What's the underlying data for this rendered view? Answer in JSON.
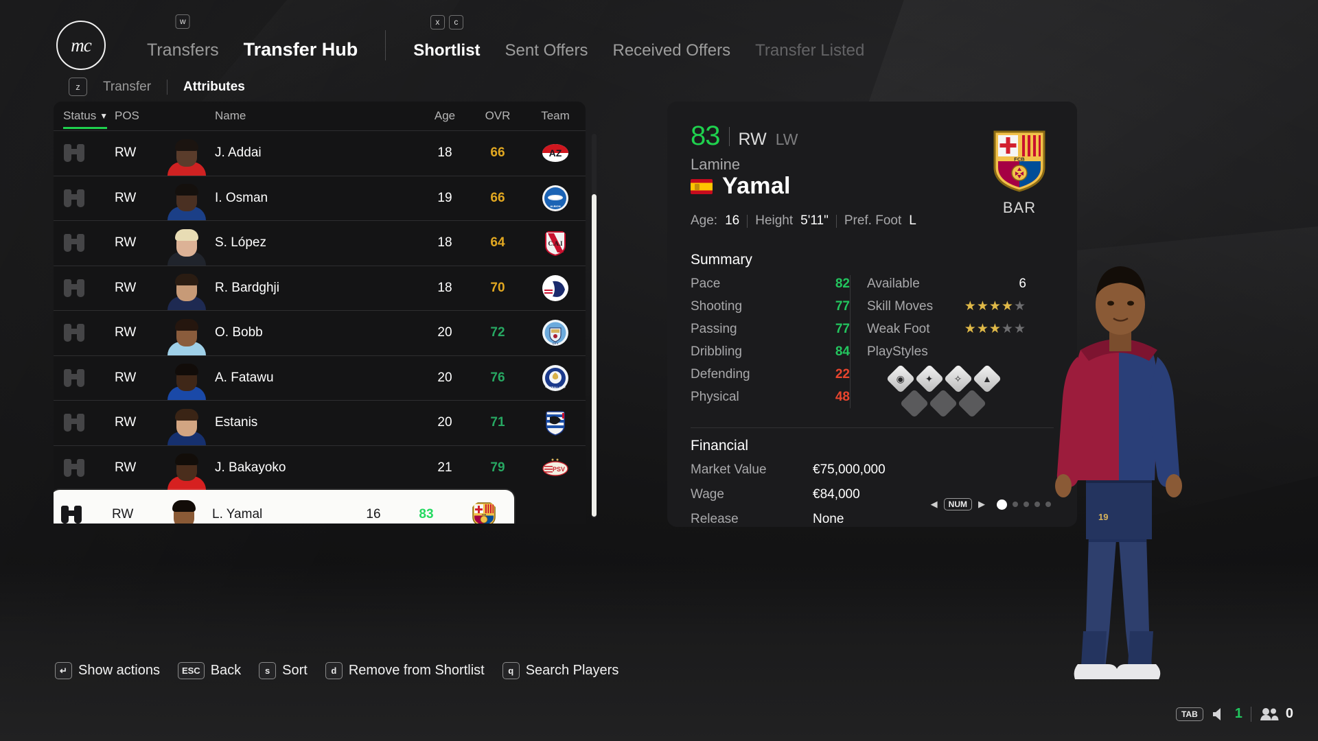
{
  "app": {
    "logo_text": "mc"
  },
  "topnav": {
    "items": [
      {
        "label": "Transfers",
        "key": "w",
        "active": false
      },
      {
        "label": "Transfer Hub",
        "key": "",
        "active": true
      }
    ],
    "subtabs": [
      {
        "label": "Shortlist",
        "active": true,
        "dim": false
      },
      {
        "label": "Sent Offers",
        "active": false,
        "dim": false
      },
      {
        "label": "Received Offers",
        "active": false,
        "dim": false
      },
      {
        "label": "Transfer Listed",
        "active": false,
        "dim": true
      }
    ],
    "subtab_keys": [
      "x",
      "c"
    ]
  },
  "viewtabs": {
    "key": "z",
    "items": [
      {
        "label": "Transfer",
        "active": false
      },
      {
        "label": "Attributes",
        "active": true
      }
    ]
  },
  "table": {
    "columns": {
      "status": "Status",
      "sort_caret": "▼",
      "pos": "POS",
      "name": "Name",
      "age": "Age",
      "ovr": "OVR",
      "team": "Team"
    },
    "rows": [
      {
        "status_icon": "binoculars-icon",
        "pos": "RW",
        "name": "J. Addai",
        "age": "18",
        "ovr": "66",
        "ovr_tone": "amber",
        "team": "AZ Alkmaar",
        "crest": "az",
        "skin": "#5a3c2b",
        "hair": "#1b1410",
        "kit": "#cf2222",
        "selected": false
      },
      {
        "status_icon": "binoculars-icon",
        "pos": "RW",
        "name": "I. Osman",
        "age": "19",
        "ovr": "66",
        "ovr_tone": "amber",
        "team": "Brighton & Hove Albion",
        "crest": "brighton",
        "skin": "#4a3022",
        "hair": "#14100d",
        "kit": "#1b3f87",
        "selected": false
      },
      {
        "status_icon": "binoculars-icon",
        "pos": "RW",
        "name": "S. López",
        "age": "18",
        "ovr": "64",
        "ovr_tone": "amber",
        "team": "Independiente",
        "crest": "independiente",
        "skin": "#dcb296",
        "hair": "#e8dcb4",
        "kit": "#20242c",
        "selected": false
      },
      {
        "status_icon": "binoculars-icon",
        "pos": "RW",
        "name": "R. Bardghji",
        "age": "18",
        "ovr": "70",
        "ovr_tone": "amber",
        "team": "FC København",
        "crest": "copenhagen",
        "skin": "#c79a77",
        "hair": "#2a1c12",
        "kit": "#1e2a52",
        "selected": false
      },
      {
        "status_icon": "binoculars-icon",
        "pos": "RW",
        "name": "O. Bobb",
        "age": "20",
        "ovr": "72",
        "ovr_tone": "green",
        "team": "Manchester City",
        "crest": "mancity",
        "skin": "#8a5c3c",
        "hair": "#25160e",
        "kit": "#9fd0e8",
        "selected": false
      },
      {
        "status_icon": "binoculars-icon",
        "pos": "RW",
        "name": "A. Fatawu",
        "age": "20",
        "ovr": "76",
        "ovr_tone": "green",
        "team": "Leicester City",
        "crest": "leicester",
        "skin": "#3f2718",
        "hair": "#110c09",
        "kit": "#1a49a8",
        "selected": false
      },
      {
        "status_icon": "binoculars-icon",
        "pos": "RW",
        "name": "Estanis",
        "age": "20",
        "ovr": "71",
        "ovr_tone": "green",
        "team": "Real Sociedad",
        "crest": "sociedad",
        "skin": "#d2a582",
        "hair": "#3a2415",
        "kit": "#16306e",
        "selected": false
      },
      {
        "status_icon": "binoculars-icon",
        "pos": "RW",
        "name": "J. Bakayoko",
        "age": "21",
        "ovr": "79",
        "ovr_tone": "green",
        "team": "PSV Eindhoven",
        "crest": "psv",
        "skin": "#4a2d1c",
        "hair": "#120d09",
        "kit": "#d62020",
        "selected": false
      },
      {
        "status_icon": "binoculars-icon",
        "pos": "RW",
        "name": "L. Yamal",
        "age": "16",
        "ovr": "83",
        "ovr_tone": "green-b",
        "team": "FC Barcelona",
        "crest": "barcelona",
        "skin": "#8a5a36",
        "hair": "#120c08",
        "kit": "#c41527",
        "selected": true
      }
    ]
  },
  "actionbar": [
    {
      "key": "↵",
      "label": "Show actions"
    },
    {
      "key": "ESC",
      "label": "Back"
    },
    {
      "key": "s",
      "label": "Sort"
    },
    {
      "key": "d",
      "label": "Remove from Shortlist"
    },
    {
      "key": "q",
      "label": "Search Players"
    }
  ],
  "detail": {
    "ovr": "83",
    "position_primary": "RW",
    "position_secondary": "LW",
    "first_name": "Lamine",
    "last_name": "Yamal",
    "nationality": "Spain",
    "age_label": "Age:",
    "age_value": "16",
    "height_label": "Height",
    "height_value": "5'11\"",
    "foot_label": "Pref. Foot",
    "foot_value": "L",
    "club_short": "BAR",
    "club_name": "FC Barcelona",
    "summary_title": "Summary",
    "attributes": [
      {
        "label": "Pace",
        "value": "82",
        "tone": "green"
      },
      {
        "label": "Shooting",
        "value": "77",
        "tone": "green"
      },
      {
        "label": "Passing",
        "value": "77",
        "tone": "green"
      },
      {
        "label": "Dribbling",
        "value": "84",
        "tone": "green"
      },
      {
        "label": "Defending",
        "value": "22",
        "tone": "red"
      },
      {
        "label": "Physical",
        "value": "48",
        "tone": "red"
      }
    ],
    "available_label": "Available",
    "available_value": "6",
    "skill_moves_label": "Skill Moves",
    "skill_moves": 4,
    "weak_foot_label": "Weak Foot",
    "weak_foot": 3,
    "star_max": 5,
    "playstyles_label": "PlayStyles",
    "playstyles": [
      {
        "icon": "finesse-shot-icon",
        "glyph": "◉",
        "filled": true
      },
      {
        "icon": "trickster-icon",
        "glyph": "✦",
        "filled": true
      },
      {
        "icon": "flair-icon",
        "glyph": "✧",
        "filled": true
      },
      {
        "icon": "rapid-icon",
        "glyph": "▲",
        "filled": true
      },
      {
        "icon": "locked-slot-icon",
        "glyph": "",
        "filled": false
      },
      {
        "icon": "locked-slot-icon",
        "glyph": "",
        "filled": false
      },
      {
        "icon": "locked-slot-icon",
        "glyph": "",
        "filled": false
      }
    ],
    "financial_title": "Financial",
    "financial": [
      {
        "label": "Market Value",
        "value": "€75,000,000"
      },
      {
        "label": "Wage",
        "value": "€84,000"
      },
      {
        "label": "Release",
        "value": "None"
      }
    ],
    "pager": {
      "prev": "◀",
      "next": "▶",
      "key": "NUM",
      "total": 5,
      "current": 1
    }
  },
  "hud": {
    "key": "TAB",
    "messages_icon": "speaker-icon",
    "messages_count": "1",
    "squad_icon": "people-icon",
    "squad_count": "0"
  },
  "colors": {
    "accent_green": "#1fd14e",
    "ovr_amber": "#e2a821",
    "ovr_green": "#27a862",
    "red": "#e8452e",
    "selected_row_bg": "#fbfbf9"
  }
}
